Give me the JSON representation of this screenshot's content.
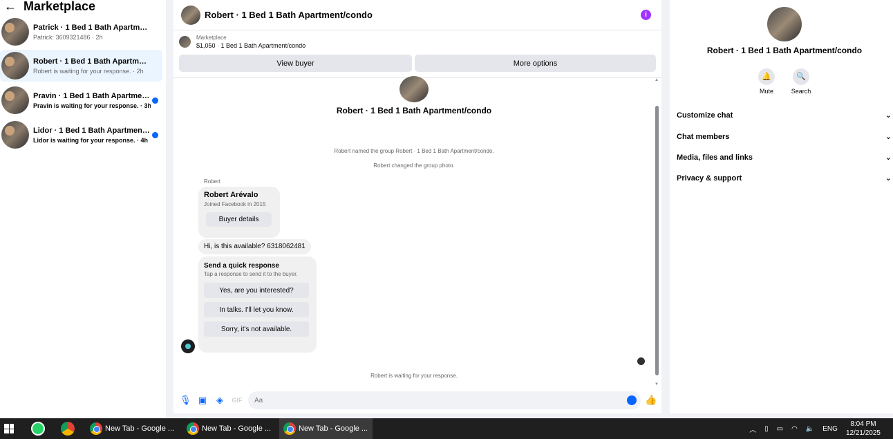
{
  "sidebar": {
    "back_icon": "←",
    "title": "Marketplace",
    "conversations": [
      {
        "title": "Patrick · 1 Bed 1 Bath Apartment/c...",
        "subtitle": "Patrick: 3609321486 · 2h",
        "unread": false,
        "active": false
      },
      {
        "title": "Robert · 1 Bed 1 Bath Apartment/c...",
        "subtitle": "Robert is waiting for your response. · 2h",
        "unread": false,
        "active": true
      },
      {
        "title": "Pravin · 1 Bed 1 Bath Apartment/...",
        "subtitle": "Pravin is waiting for your response. · 3h",
        "unread": true,
        "active": false
      },
      {
        "title": "Lidor · 1 Bed 1 Bath Apartment/c...",
        "subtitle": "Lidor is waiting for your response. · 4h",
        "unread": true,
        "active": false
      }
    ]
  },
  "chat": {
    "header_title": "Robert · 1 Bed 1 Bath Apartment/condo",
    "info_icon": "i",
    "listing_label": "Marketplace",
    "listing_price_title": "$1,050 · 1 Bed 1 Bath Apartment/condo",
    "view_buyer_label": "View buyer",
    "more_options_label": "More options",
    "group_name": "Robert · 1 Bed 1 Bath Apartment/condo",
    "system_messages": [
      "Robert named the group Robert · 1 Bed 1 Bath Apartment/condo.",
      "Robert changed the group photo."
    ],
    "sender_label": "Robert",
    "buyer_card": {
      "name": "Robert Arévalo",
      "joined": "Joined Facebook in 2015",
      "details_button": "Buyer details"
    },
    "message": "Hi, is this available? 6318062481",
    "quick_response": {
      "heading": "Send a quick response",
      "subtitle": "Tap a response to send it to the buyer.",
      "options": [
        "Yes, are you interested?",
        "In talks. I'll let you know.",
        "Sorry, it's not available."
      ]
    },
    "waiting_text": "Robert is waiting for your response.",
    "input_placeholder": "Aa"
  },
  "details": {
    "name": "Robert · 1 Bed 1 Bath Apartment/condo",
    "actions": [
      {
        "icon": "bell-icon",
        "label": "Mute"
      },
      {
        "icon": "search-icon",
        "label": "Search"
      }
    ],
    "sections": [
      "Customize chat",
      "Chat members",
      "Media, files and links",
      "Privacy & support"
    ]
  },
  "taskbar": {
    "tabs": [
      "New Tab - Google ...",
      "New Tab - Google ...",
      "New Tab - Google ..."
    ],
    "language": "ENG",
    "time": "8:04 PM",
    "date": "12/21/2025"
  }
}
